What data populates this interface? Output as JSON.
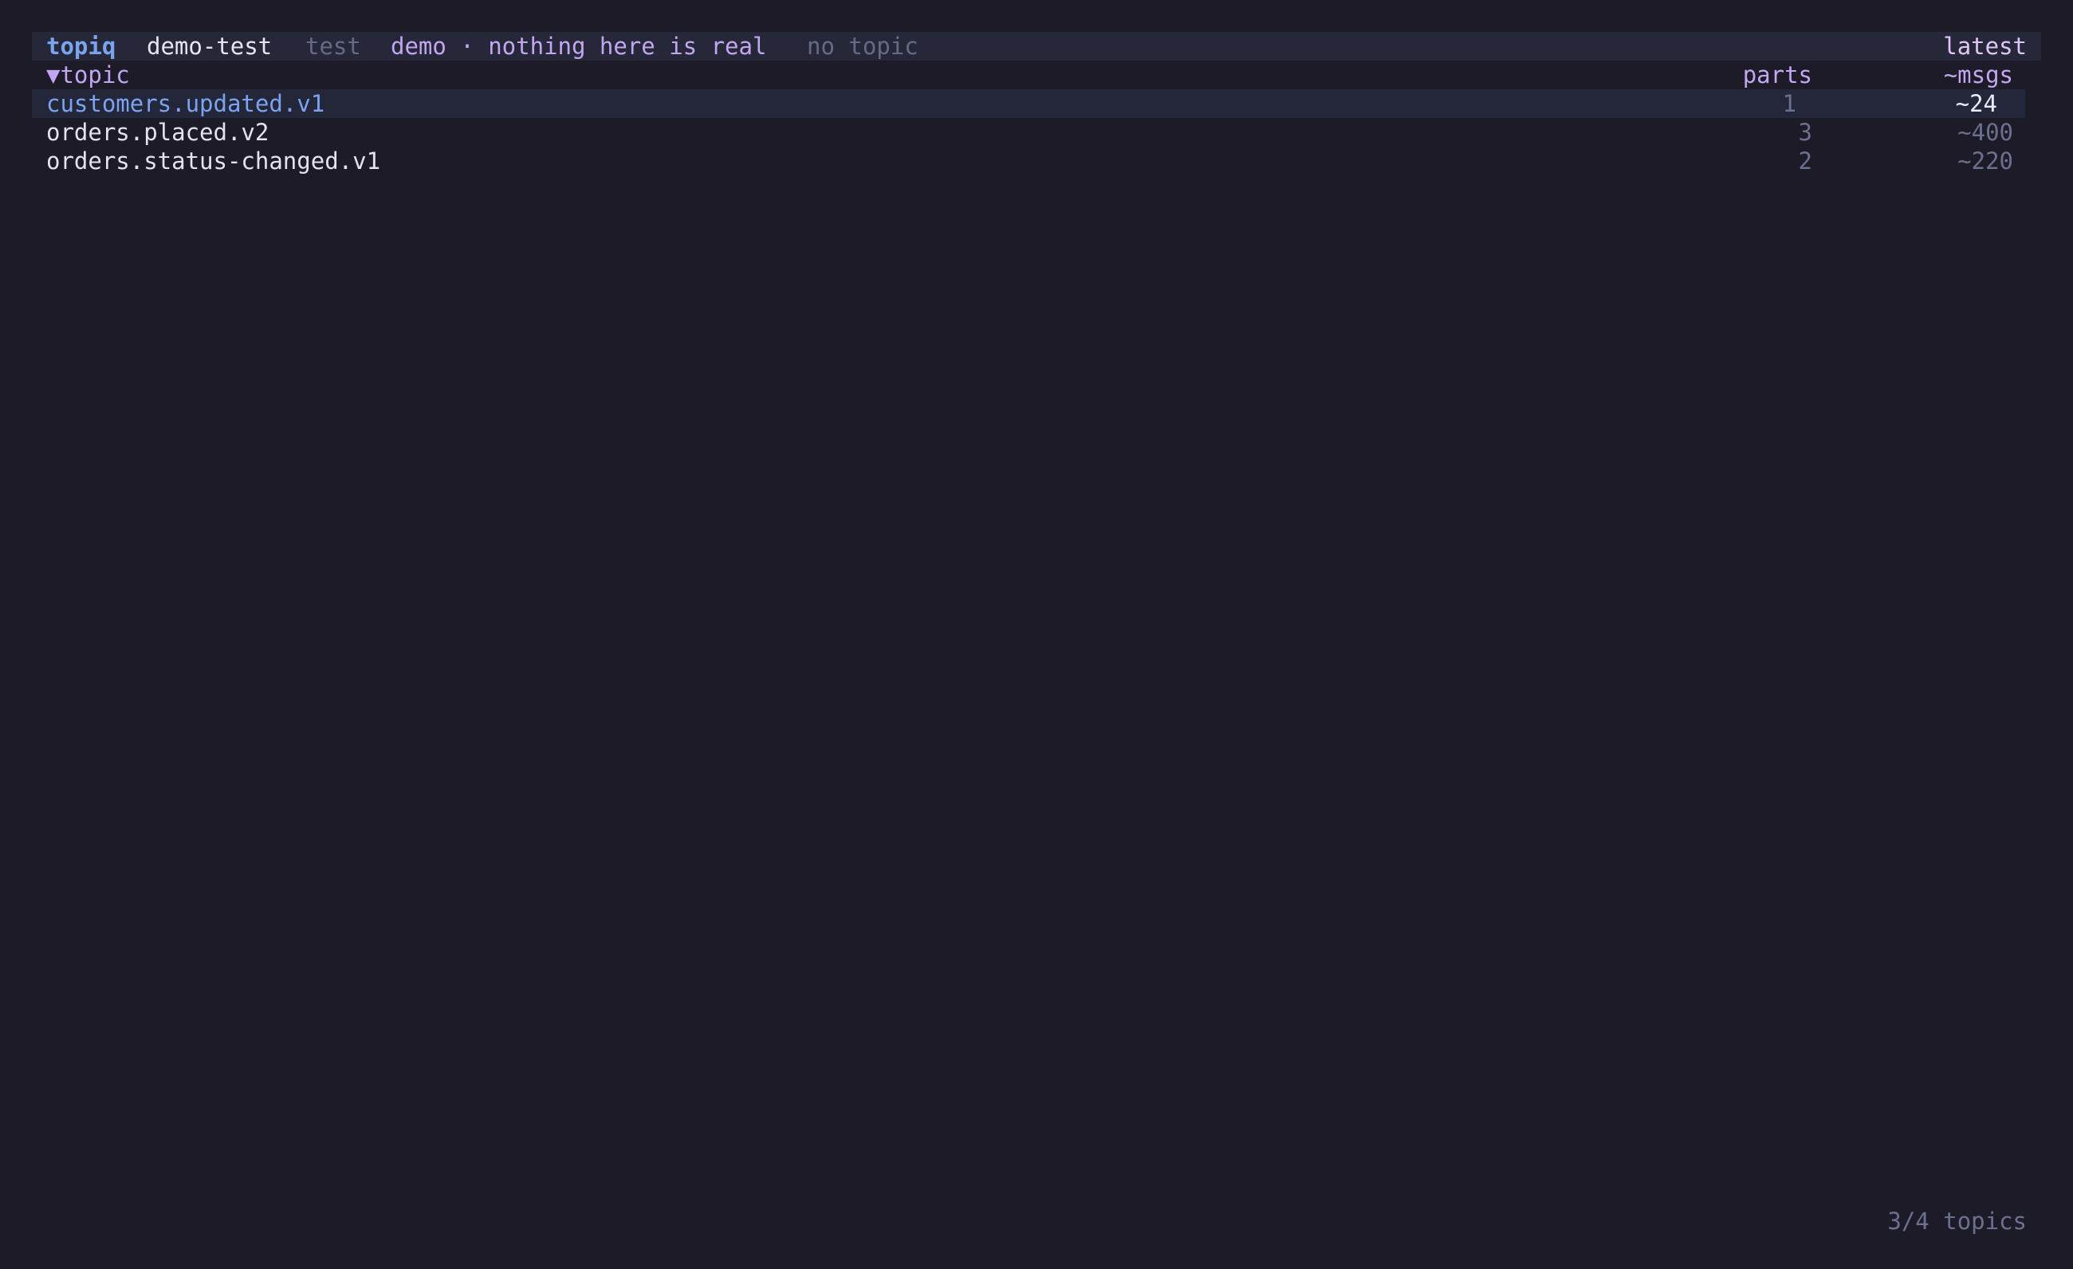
{
  "status_bar": {
    "app_name": "topiq",
    "cluster": "demo-test",
    "environment": "test",
    "context": "demo · nothing here is real",
    "topic_state": "no topic",
    "offset_mode": "latest"
  },
  "table": {
    "headers": {
      "topic": "▼topic",
      "parts": "parts",
      "msgs": "~msgs"
    },
    "rows": [
      {
        "topic": "customers.updated.v1",
        "parts": "1",
        "msgs": "~24",
        "selected": true
      },
      {
        "topic": "orders.placed.v2",
        "parts": "3",
        "msgs": "~400",
        "selected": false
      },
      {
        "topic": "orders.status-changed.v1",
        "parts": "2",
        "msgs": "~220",
        "selected": false
      }
    ]
  },
  "footer": {
    "count": "3/4 topics"
  },
  "colors": {
    "background": "#1c1b27",
    "status_bar_bg": "#262839",
    "accent_blue": "#7aa4f0",
    "accent_purple": "#c3a6f2",
    "dim": "#6c7090"
  }
}
